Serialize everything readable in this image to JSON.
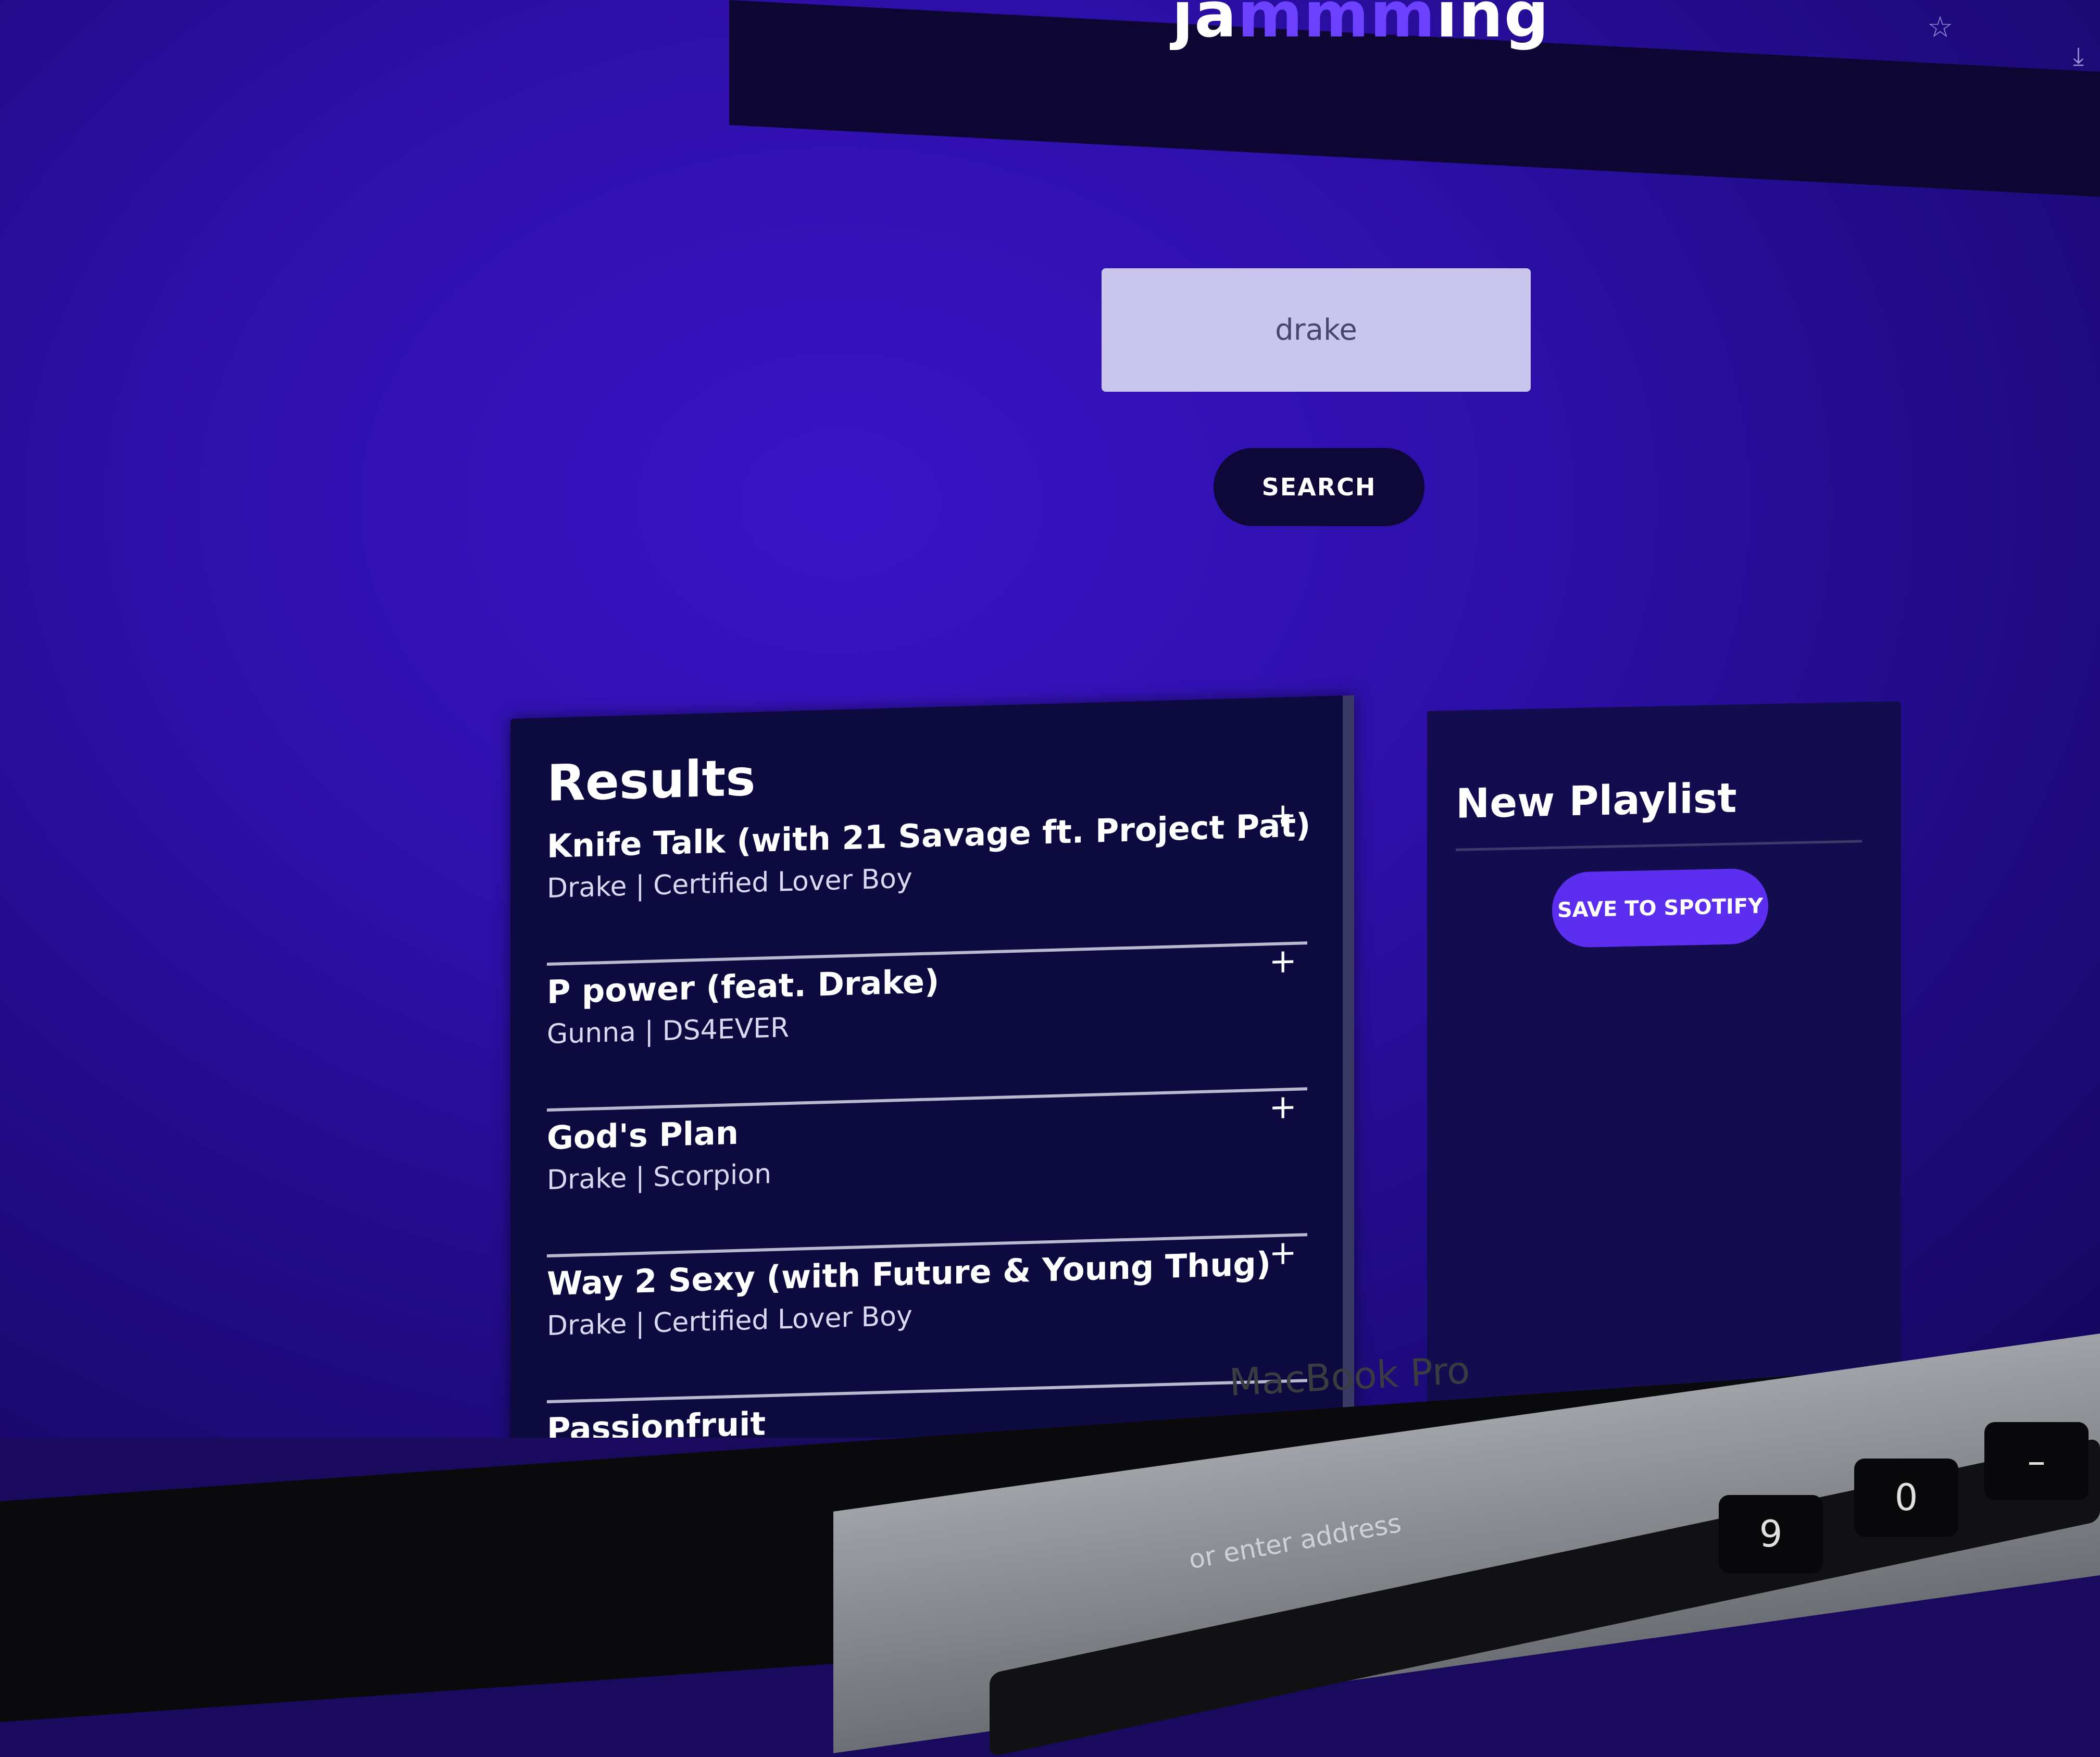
{
  "app": {
    "logo_main": "ja",
    "logo_accent": "mmm",
    "logo_tail": "ing"
  },
  "browser": {
    "star_icon": "☆",
    "download_icon": "⤓"
  },
  "search": {
    "value": "drake",
    "button_label": "SEARCH"
  },
  "results": {
    "title": "Results",
    "add_glyph": "+",
    "tracks": [
      {
        "name": "Knife Talk (with 21 Savage ft. Project Pat)",
        "info": "Drake | Certified Lover Boy"
      },
      {
        "name": "P power (feat. Drake)",
        "info": "Gunna | DS4EVER"
      },
      {
        "name": "God's Plan",
        "info": "Drake | Scorpion"
      },
      {
        "name": "Way 2 Sexy (with Future & Young Thug)",
        "info": "Drake | Certified Lover Boy"
      },
      {
        "name": "Passionfruit",
        "info": ""
      }
    ]
  },
  "playlist": {
    "name": "New Playlist",
    "save_label": "SAVE TO SPOTIFY"
  },
  "device": {
    "brand": "MacBook Pro",
    "touchbar_hint": "or enter address"
  },
  "keys": [
    "9",
    "0",
    "–"
  ],
  "colors": {
    "accent": "#5b2ef0",
    "background": "#2c0fa6",
    "panel": "#0c0a3f"
  }
}
